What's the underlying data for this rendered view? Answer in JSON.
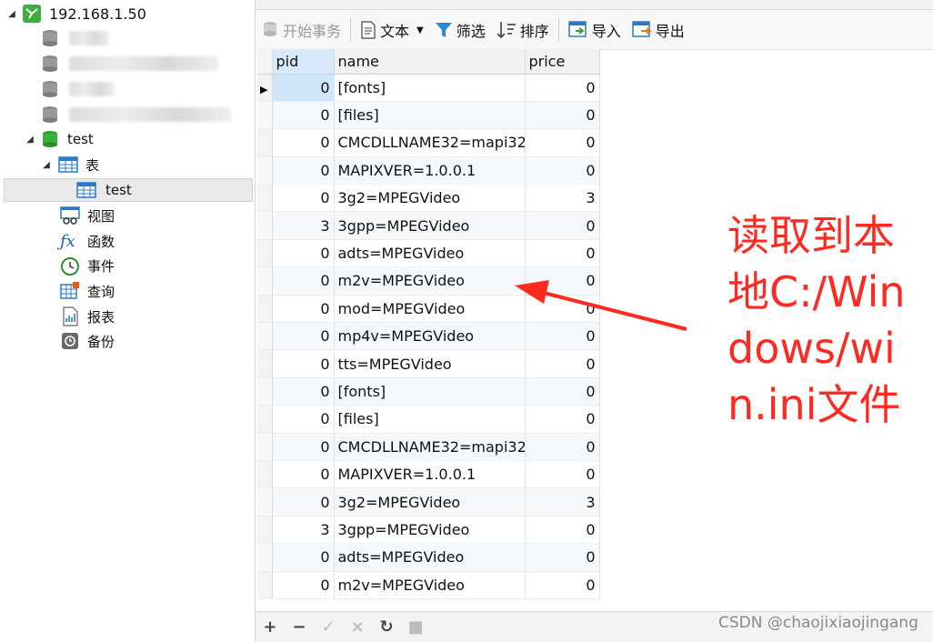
{
  "sidebar": {
    "connection": "192.168.1.50",
    "database": "test",
    "tables_group": "表",
    "table": "test",
    "views": "视图",
    "functions": "函数",
    "events": "事件",
    "queries": "查询",
    "reports": "报表",
    "backups": "备份"
  },
  "toolbar": {
    "begin_transaction": "开始事务",
    "text": "文本",
    "filter": "筛选",
    "sort": "排序",
    "import": "导入",
    "export": "导出"
  },
  "grid": {
    "columns": [
      "pid",
      "name",
      "price"
    ],
    "rows": [
      [
        "0",
        "[fonts]",
        "0"
      ],
      [
        "0",
        "[files]",
        "0"
      ],
      [
        "0",
        "CMCDLLNAME32=mapi32",
        "0"
      ],
      [
        "0",
        "MAPIXVER=1.0.0.1",
        "0"
      ],
      [
        "0",
        "3g2=MPEGVideo",
        "3"
      ],
      [
        "3",
        "3gpp=MPEGVideo",
        "0"
      ],
      [
        "0",
        "adts=MPEGVideo",
        "0"
      ],
      [
        "0",
        "m2v=MPEGVideo",
        "0"
      ],
      [
        "0",
        "mod=MPEGVideo",
        "0"
      ],
      [
        "0",
        "mp4v=MPEGVideo",
        "0"
      ],
      [
        "0",
        "tts=MPEGVideo",
        "0"
      ],
      [
        "0",
        "[fonts]",
        "0"
      ],
      [
        "0",
        "[files]",
        "0"
      ],
      [
        "0",
        "CMCDLLNAME32=mapi32",
        "0"
      ],
      [
        "0",
        "MAPIXVER=1.0.0.1",
        "0"
      ],
      [
        "0",
        "3g2=MPEGVideo",
        "3"
      ],
      [
        "3",
        "3gpp=MPEGVideo",
        "0"
      ],
      [
        "0",
        "adts=MPEGVideo",
        "0"
      ],
      [
        "0",
        "m2v=MPEGVideo",
        "0"
      ]
    ]
  },
  "bottombar": {
    "add": "+",
    "remove": "−",
    "apply": "✓",
    "discard": "×",
    "refresh": "↻",
    "stop": "■"
  },
  "annotation": "读取到本地C:/Windows/win.ini文件",
  "watermark": "CSDN @chaojixiaojingang",
  "colors": {
    "annotation": "#ff2a1f",
    "selected_cell": "#cfe6fb"
  }
}
